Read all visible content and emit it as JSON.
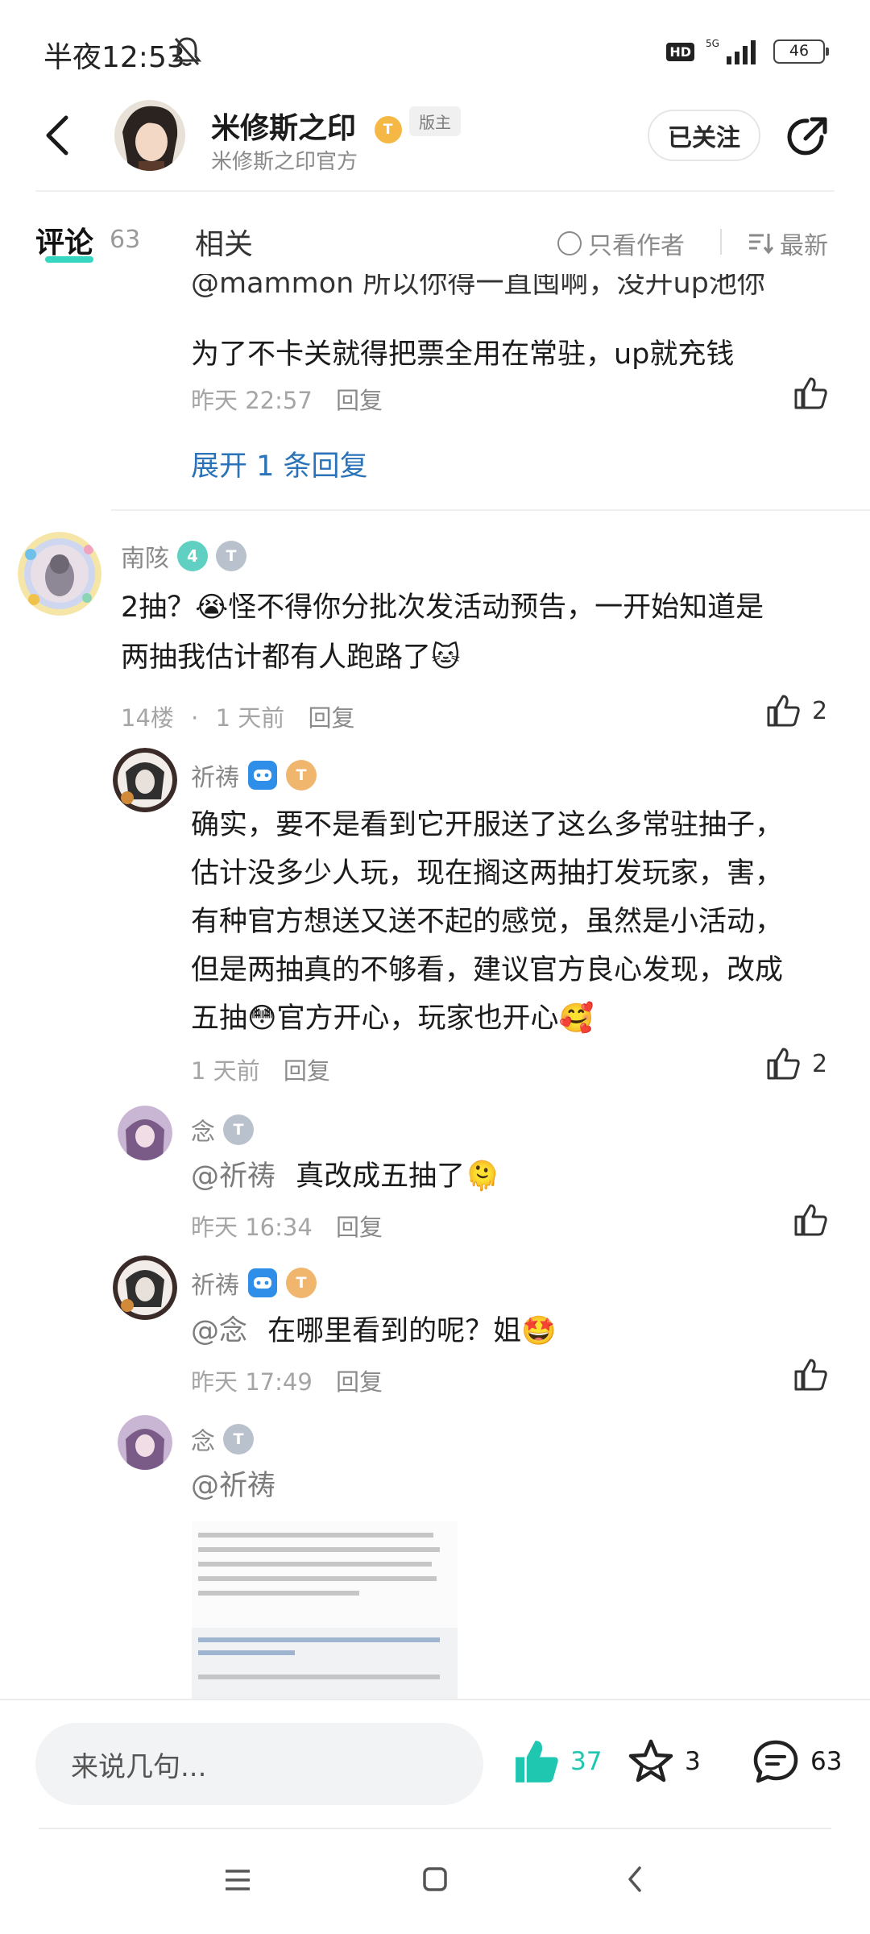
{
  "status_bar": {
    "time": "半夜12:53",
    "network": "5G",
    "battery": "46"
  },
  "header": {
    "title": "米修斯之印",
    "level_badge": "T",
    "role_tag": "版主",
    "subtitle": "米修斯之印官方",
    "follow_label": "已关注"
  },
  "tabs": {
    "comments_label": "评论",
    "comments_count": "63",
    "related_label": "相关",
    "only_author_label": "只看作者",
    "sort_label": "最新"
  },
  "partial_reply": {
    "line1": "@mammon  所以你得一直囤啊，没开up池你",
    "line2": "为了不卡关就得把票全用在常驻，up就充钱",
    "time": "昨天 22:57",
    "reply_label": "回复",
    "expand_label": "展开 1 条回复"
  },
  "main_comment": {
    "username": "南陔",
    "badge_number": "4",
    "badge_letter": "T",
    "text_line1": "2抽？😭怪不得你分批次发活动预告，一开始知道是",
    "text_line2": "两抽我估计都有人跑路了🐱",
    "floor": "14楼",
    "dot": "·",
    "time": "1 天前",
    "reply_label": "回复",
    "likes": "2"
  },
  "replies": [
    {
      "username": "祈祷",
      "badge_letter": "T",
      "lines": [
        "确实，要不是看到它开服送了这么多常驻抽子，",
        "估计没多少人玩，现在搁这两抽打发玩家，害，",
        "有种官方想送又送不起的感觉，虽然是小活动，",
        "但是两抽真的不够看，建议官方良心发现，改成",
        "五抽😳官方开心，玩家也开心🥰"
      ],
      "time": "1 天前",
      "reply_label": "回复",
      "likes": "2"
    },
    {
      "username": "念",
      "badge_letter": "T",
      "mention": "@祈祷",
      "text": "真改成五抽了🫠",
      "time": "昨天 16:34",
      "reply_label": "回复"
    },
    {
      "username": "祈祷",
      "badge_letter": "T",
      "mention": "@念",
      "text": "在哪里看到的呢？姐🤩",
      "time": "昨天 17:49",
      "reply_label": "回复"
    },
    {
      "username": "念",
      "badge_letter": "T",
      "mention": "@祈祷",
      "text": ""
    }
  ],
  "bottom_bar": {
    "input_placeholder": "来说几句...",
    "likes": "37",
    "favorites": "3",
    "comments": "63"
  },
  "colors": {
    "accent_teal": "#35d7c1",
    "link_blue": "#2a73b8",
    "like_green": "#1fc7b1",
    "badge_gold": "#f5b844",
    "badge_silver": "#b9c2cc"
  },
  "icons": [
    "back-arrow-icon",
    "share-icon",
    "thumbs-up-icon",
    "star-icon",
    "comment-bubble-icon",
    "menu-icon",
    "home-icon",
    "back-nav-icon"
  ]
}
